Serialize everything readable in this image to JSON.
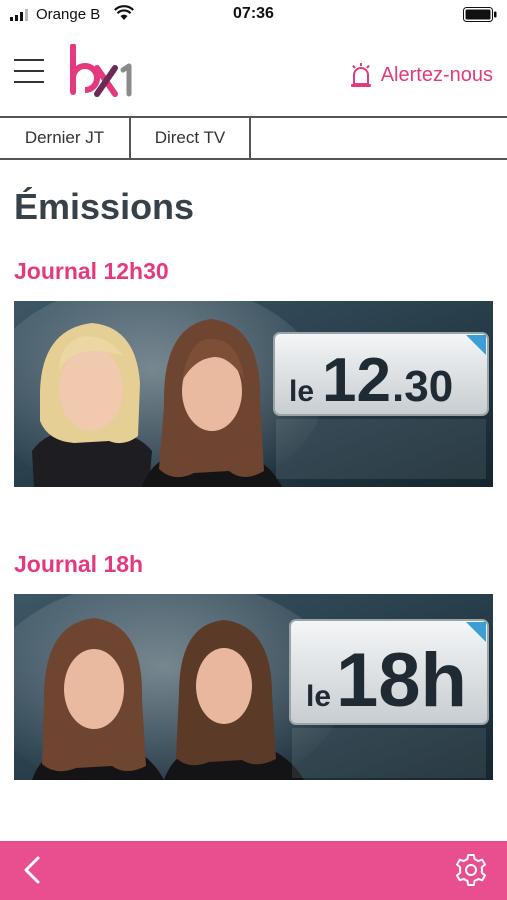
{
  "status_bar": {
    "carrier": "Orange B",
    "time": "07:36"
  },
  "header": {
    "logo_text": "bx1",
    "alert_label": "Alertez-nous"
  },
  "tabs": [
    {
      "label": "Dernier JT"
    },
    {
      "label": "Direct TV"
    }
  ],
  "page": {
    "title": "Émissions",
    "shows": [
      {
        "title": "Journal 12h30",
        "thumb_prefix": "le",
        "thumb_main": "12",
        "thumb_suffix": ".30"
      },
      {
        "title": "Journal 18h",
        "thumb_prefix": "le",
        "thumb_main": "18h",
        "thumb_suffix": ""
      }
    ]
  },
  "colors": {
    "accent": "#e5397f",
    "bottom_bar": "#e94e8f",
    "title": "#37414a"
  },
  "icons": {
    "menu": "hamburger-icon",
    "alert": "alarm-light-icon",
    "back": "chevron-left-icon",
    "settings": "gear-icon"
  }
}
